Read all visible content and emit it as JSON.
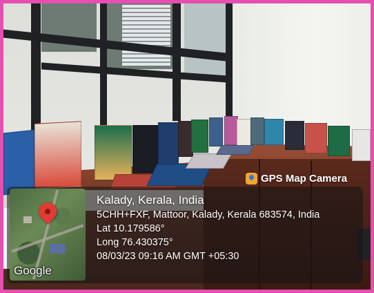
{
  "badge": {
    "label": "GPS Map Camera",
    "icon": "gps-map-camera-icon"
  },
  "location": {
    "place": "Kalady, Kerala, India",
    "address": "5CHH+FXF, Mattoor, Kalady, Kerala 683574, India",
    "latitude": "Lat 10.179586°",
    "longitude": "Long 76.430375°",
    "datetime": "08/03/23 09:16 AM GMT +05:30"
  },
  "map": {
    "brand": "Google",
    "pin_icon": "location-pin-icon"
  },
  "colors": {
    "border": "#e44fb0",
    "pin": "#e23a34",
    "badge_icon": "#f2a631"
  }
}
